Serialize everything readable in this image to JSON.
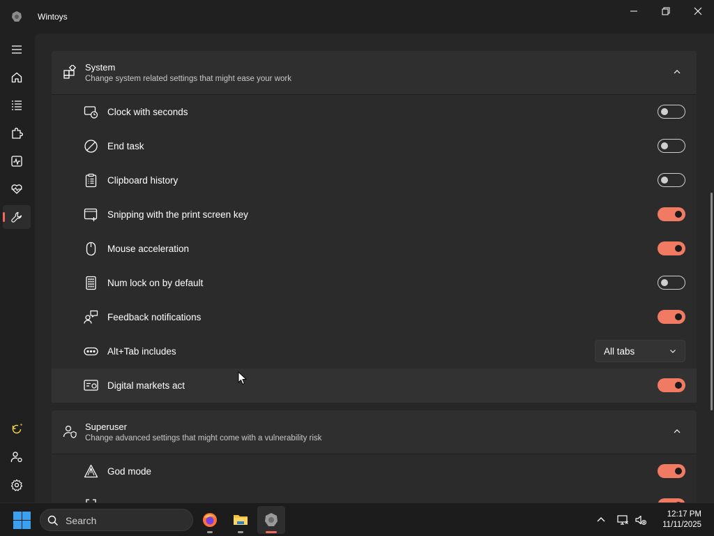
{
  "window": {
    "title": "Wintoys"
  },
  "nav": {
    "items": [
      {
        "icon": "menu-icon"
      },
      {
        "icon": "home-icon"
      },
      {
        "icon": "apps-list-icon"
      },
      {
        "icon": "puzzle-icon"
      },
      {
        "icon": "activity-icon"
      },
      {
        "icon": "heartbeat-icon"
      },
      {
        "icon": "wrench-icon",
        "active": true
      }
    ],
    "bottom": [
      {
        "icon": "refresh-icon"
      },
      {
        "icon": "user-settings-icon"
      },
      {
        "icon": "gear-icon"
      }
    ]
  },
  "system_section": {
    "title": "System",
    "subtitle": "Change system related settings that might ease your work",
    "rows": [
      {
        "label": "Clock with seconds",
        "icon": "clock-icon",
        "control": "toggle",
        "on": false
      },
      {
        "label": "End task",
        "icon": "block-icon",
        "control": "toggle",
        "on": false
      },
      {
        "label": "Clipboard history",
        "icon": "clipboard-icon",
        "control": "toggle",
        "on": false
      },
      {
        "label": "Snipping with the print screen key",
        "icon": "snip-icon",
        "control": "toggle",
        "on": true
      },
      {
        "label": "Mouse acceleration",
        "icon": "mouse-icon",
        "control": "toggle",
        "on": true
      },
      {
        "label": "Num lock on by default",
        "icon": "numpad-icon",
        "control": "toggle",
        "on": false
      },
      {
        "label": "Feedback notifications",
        "icon": "feedback-icon",
        "control": "toggle",
        "on": true
      },
      {
        "label": "Alt+Tab includes",
        "icon": "alttab-icon",
        "control": "dropdown",
        "value": "All tabs"
      },
      {
        "label": "Digital markets act",
        "icon": "certificate-icon",
        "control": "toggle",
        "on": true
      }
    ]
  },
  "superuser_section": {
    "title": "Superuser",
    "subtitle": "Change advanced settings that might come with a vulnerability risk",
    "rows": [
      {
        "label": "God mode",
        "icon": "warning-icon",
        "control": "toggle",
        "on": true
      }
    ]
  },
  "taskbar": {
    "search_placeholder": "Search",
    "time": "12:17 PM",
    "date": "11/11/2025"
  },
  "colors": {
    "accent": "#f07a62",
    "background": "#202020",
    "card": "#2b2b2b"
  }
}
